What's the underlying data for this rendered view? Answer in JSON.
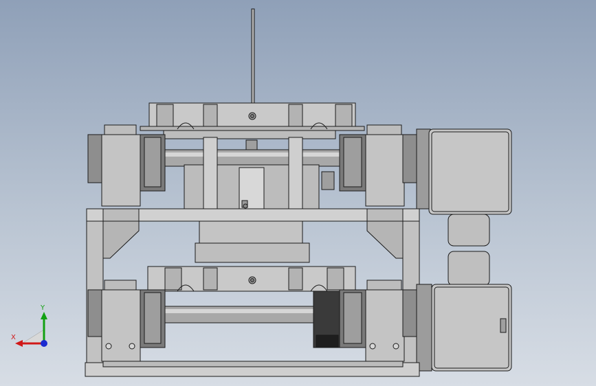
{
  "viewport": {
    "background_top": "#8fa0b8",
    "background_bottom": "#d7dde5"
  },
  "model": {
    "part_fill": "#c9c9c9",
    "part_shade": "#9c9c9c",
    "part_dark": "#6e6e6e",
    "edge_color": "#1a1a1a",
    "belt_color": "#2a2a2a"
  },
  "triad": {
    "x_label": "X",
    "y_label": "Y",
    "x_color": "#d01818",
    "y_color": "#12a012",
    "z_color": "#1a2ad0",
    "icon": "coordinate-triad-icon"
  }
}
